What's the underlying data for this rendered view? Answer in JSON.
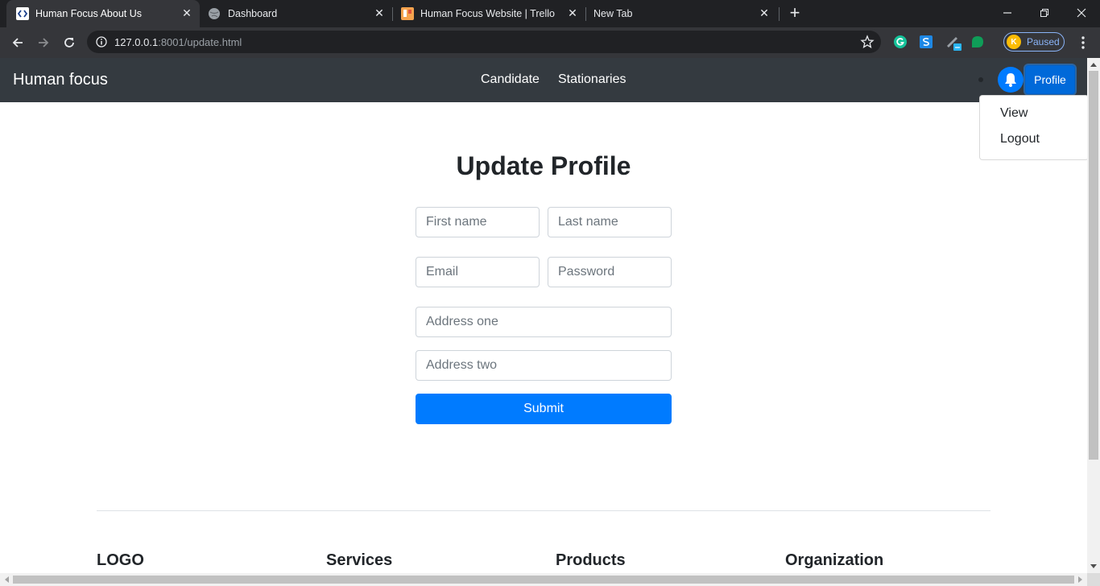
{
  "browser": {
    "tabs": [
      {
        "title": "Human Focus About Us",
        "active": true
      },
      {
        "title": "Dashboard",
        "active": false
      },
      {
        "title": "Human Focus Website | Trello",
        "active": false
      },
      {
        "title": "New Tab",
        "active": false
      }
    ],
    "url_host": "127.0.0.1",
    "url_rest": ":8001/update.html",
    "profile_initial": "K",
    "profile_status": "Paused"
  },
  "navbar": {
    "brand": "Human focus",
    "links": [
      "Candidate",
      "Stationaries"
    ],
    "profile_label": "Profile"
  },
  "dropdown": {
    "items": [
      "View",
      "Logout"
    ]
  },
  "form": {
    "title": "Update Profile",
    "first_name_placeholder": "First name",
    "last_name_placeholder": "Last name",
    "email_placeholder": "Email",
    "password_placeholder": "Password",
    "address_one_placeholder": "Address one",
    "address_two_placeholder": "Address two",
    "submit_label": "Submit"
  },
  "footer": {
    "headings": [
      "LOGO",
      "Services",
      "Products",
      "Organization"
    ]
  },
  "colors": {
    "navbar_bg": "#343a40",
    "primary": "#007bff"
  }
}
